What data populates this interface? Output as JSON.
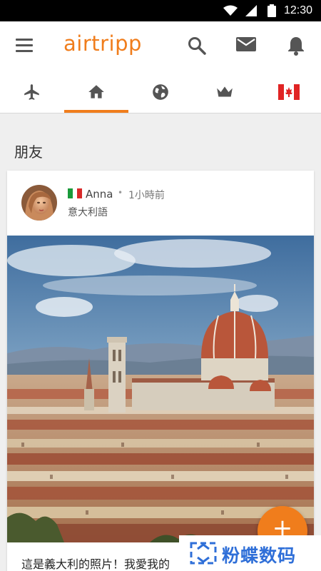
{
  "status_bar": {
    "time": "12:30",
    "icons": [
      "wifi-icon",
      "signal-icon",
      "battery-icon"
    ]
  },
  "app_bar": {
    "logo": "airtripp",
    "icons": [
      "menu-icon",
      "search-icon",
      "mail-icon",
      "bell-icon"
    ]
  },
  "tabs": [
    {
      "icon": "airplane-icon",
      "active": false
    },
    {
      "icon": "home-icon",
      "active": true
    },
    {
      "icon": "globe-icon",
      "active": false
    },
    {
      "icon": "crown-icon",
      "active": false
    },
    {
      "icon": "canada-flag-icon",
      "active": false
    }
  ],
  "section": {
    "title": "朋友"
  },
  "post": {
    "author": "Anna",
    "separator": "•",
    "time_ago": "1小時前",
    "language": "意大利語",
    "flag": "italy-flag-icon",
    "caption": "這是義大利的照片！我愛我的"
  },
  "fab": {
    "label": "+"
  },
  "watermark": {
    "text": "粉蝶数码"
  },
  "colors": {
    "accent": "#f07d1c",
    "status_bar": "#000000",
    "watermark": "#2f6fd8"
  }
}
